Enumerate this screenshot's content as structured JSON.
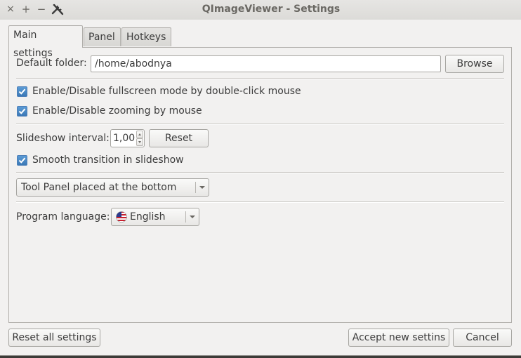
{
  "window": {
    "title": "QImageViewer - Settings",
    "controls": {
      "close_glyph": "×",
      "maximize_glyph": "+",
      "minimize_glyph": "−",
      "app_icon": "tools-icon"
    }
  },
  "tabs": [
    {
      "label": "Main settings",
      "active": true
    },
    {
      "label": "Panel",
      "active": false
    },
    {
      "label": "Hotkeys",
      "active": false
    }
  ],
  "main": {
    "default_folder": {
      "label": "Default folder:",
      "value": "/home/abodnya",
      "browse_label": "Browse"
    },
    "fullscreen_checkbox": {
      "label": "Enable/Disable fullscreen mode by double-click mouse",
      "checked": true
    },
    "zoom_checkbox": {
      "label": "Enable/Disable zooming by mouse",
      "checked": true
    },
    "slideshow": {
      "label": "Slideshow interval:",
      "value": "1,00",
      "reset_label": "Reset"
    },
    "smooth_checkbox": {
      "label": "Smooth transition in slideshow",
      "checked": true
    },
    "panel_position": {
      "selected": "Tool Panel placed at the bottom"
    },
    "language": {
      "label": "Program language:",
      "selected": "English",
      "flag_icon": "us-flag-icon"
    }
  },
  "footer": {
    "reset_all_label": "Reset all settings",
    "accept_label": "Accept new settins",
    "cancel_label": "Cancel"
  },
  "colors": {
    "window_bg": "#f2f1f0",
    "checkbox_accent": "#3b78b6"
  }
}
